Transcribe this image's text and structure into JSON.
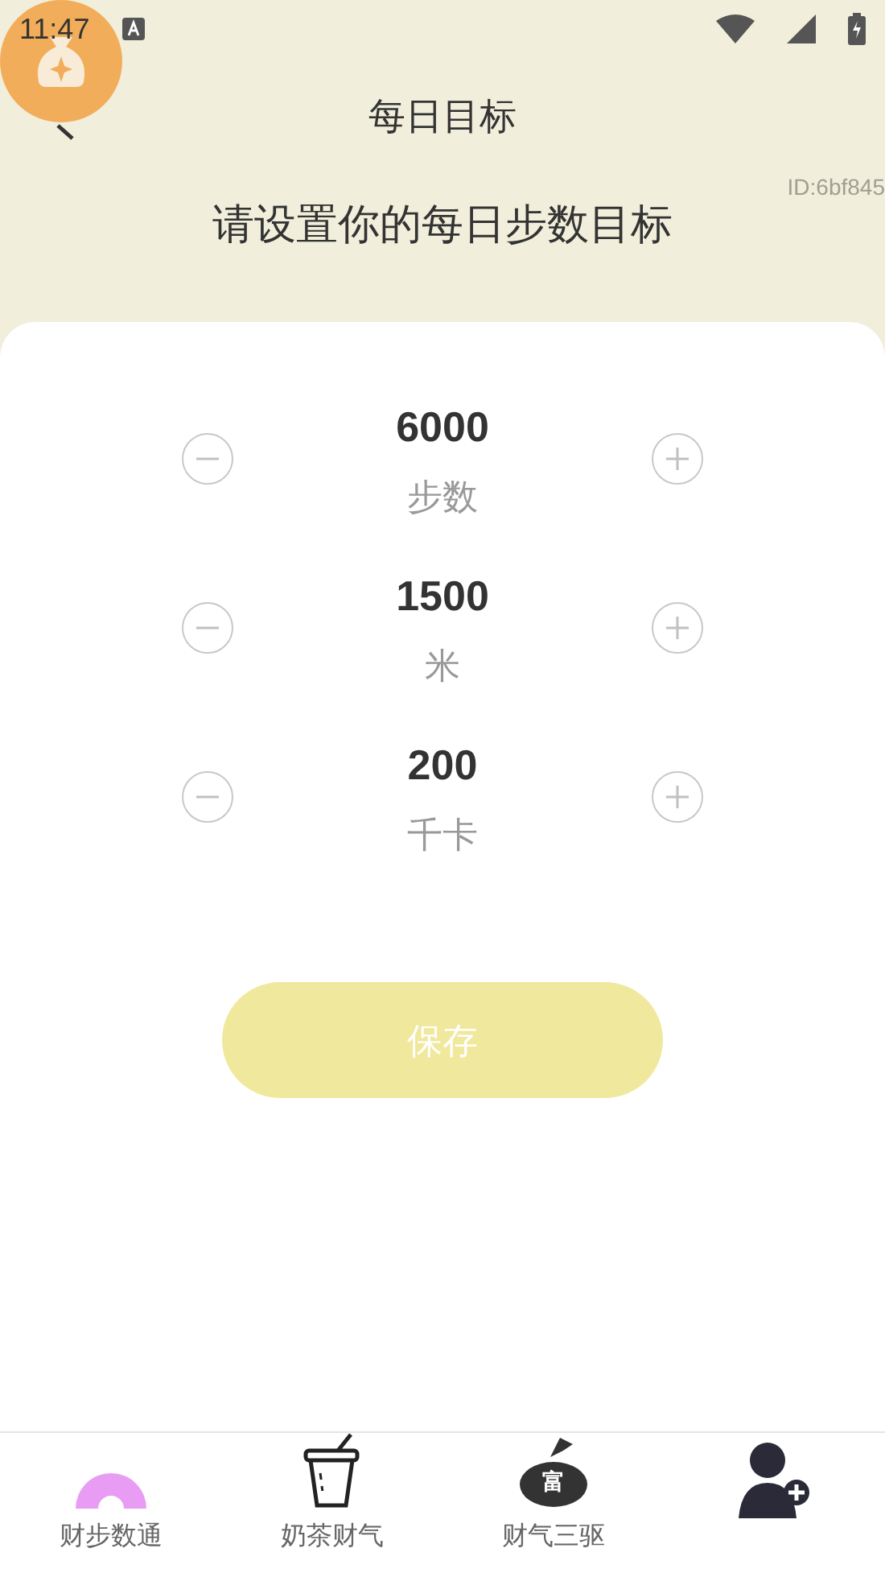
{
  "status_bar": {
    "time": "11:47"
  },
  "header": {
    "title": "每日目标",
    "subtitle": "请设置你的每日步数目标",
    "id_label": "ID:6bf845"
  },
  "goals": [
    {
      "value": "6000",
      "unit": "步数"
    },
    {
      "value": "1500",
      "unit": "米"
    },
    {
      "value": "200",
      "unit": "千卡"
    }
  ],
  "save_button": {
    "label": "保存"
  },
  "bottom_nav": [
    {
      "kind": "arch",
      "label": "财步数通"
    },
    {
      "kind": "cup",
      "label": "奶茶财气"
    },
    {
      "kind": "bag",
      "label": "财气三驱",
      "icon_text": "富"
    },
    {
      "kind": "profile"
    }
  ]
}
